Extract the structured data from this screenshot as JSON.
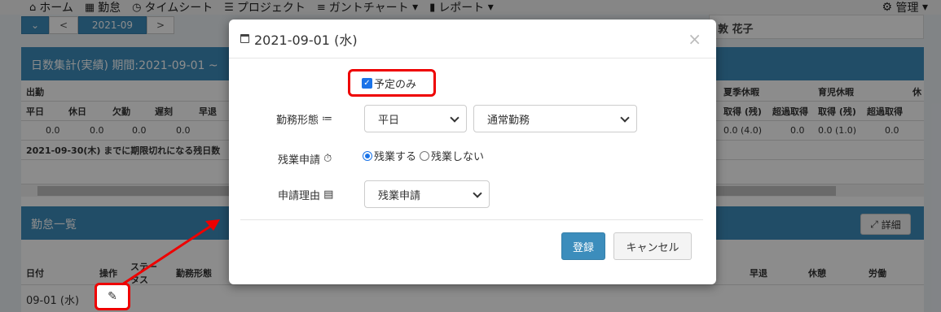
{
  "navbar": {
    "home": "ホーム",
    "attendance": "勤怠",
    "timesheet": "タイムシート",
    "project": "プロジェクト",
    "gantt": "ガントチャート",
    "report": "レポート",
    "admin": "管理"
  },
  "month_bar": {
    "current": "2021-09",
    "prev": "<",
    "next": ">"
  },
  "user": {
    "name": "敦 花子"
  },
  "summary_box": {
    "title": "日数集計(実績)  期間:2021-09-01 ~",
    "col_group": "出勤",
    "headers": [
      "平日",
      "休日",
      "欠勤",
      "遅刻",
      "早退"
    ],
    "values": [
      "0.0",
      "0.0",
      "0.0",
      "0.0"
    ],
    "right_groups": [
      "夏季休暇",
      "育児休暇",
      "休"
    ],
    "right_headers": [
      "取得 (残)",
      "超過取得",
      "取得 (残)",
      "超過取得"
    ],
    "right_values": [
      "0.0 (4.0)",
      "0.0",
      "0.0 (1.0)",
      "0.0"
    ],
    "note": "2021-09-30(木) までに期限切れになる残日数"
  },
  "list_box": {
    "title": "勤怠一覧",
    "detail_button": "詳細",
    "headers": [
      "日付",
      "操作",
      "ステータス",
      "勤務形態",
      "早退",
      "休憩",
      "労働"
    ],
    "row_date": "09-01 (水)"
  },
  "modal": {
    "title": "2021-09-01 (水)",
    "plan_only_label": "予定のみ",
    "work_type_label": "勤務形態",
    "work_type_value": "平日",
    "work_pattern_value": "通常勤務",
    "overtime_label": "残業申請",
    "overtime_yes": "残業する",
    "overtime_no": "残業しない",
    "reason_label": "申請理由",
    "reason_value": "残業申請",
    "submit_button": "登録",
    "cancel_button": "キャンセル",
    "close_symbol": "×"
  },
  "colors": {
    "primary": "#3c8dbc",
    "highlight": "#e00000"
  }
}
